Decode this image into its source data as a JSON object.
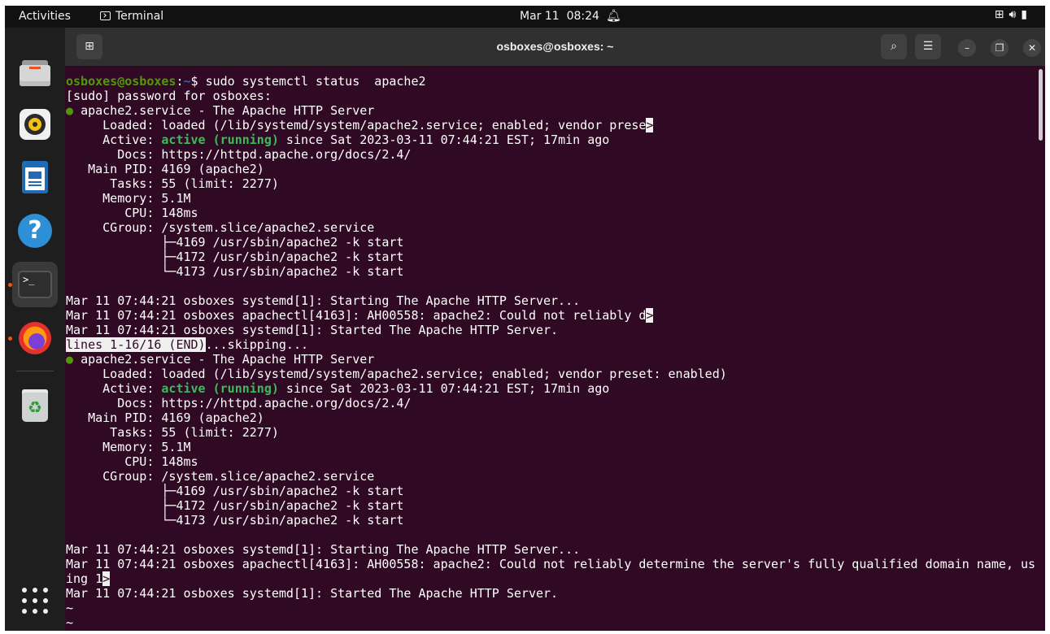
{
  "topbar": {
    "activities": "Activities",
    "app_name": "Terminal",
    "clock": "Mar 11  08:24"
  },
  "dock": {
    "items": [
      "files-icon",
      "rhythmbox-icon",
      "libreoffice-writer-icon",
      "help-icon",
      "terminal-icon",
      "firefox-icon",
      "trash-icon",
      "show-apps-icon"
    ]
  },
  "window": {
    "title": "osboxes@osboxes: ~"
  },
  "terminal": {
    "prompt_user": "osboxes@osboxes",
    "prompt_sep": ":",
    "prompt_path": "~",
    "prompt_symbol": "$ ",
    "command": "sudo systemctl status  apache2",
    "lines": {
      "sudo": "[sudo] password for osboxes:",
      "svc": "apache2.service - The Apache HTTP Server",
      "loaded_short": "     Loaded: loaded (/lib/systemd/system/apache2.service; enabled; vendor prese",
      "loaded_full": "     Loaded: loaded (/lib/systemd/system/apache2.service; enabled; vendor preset: enabled)",
      "active_label": "     Active: ",
      "active_state": "active (running)",
      "active_rest": " since Sat 2023-03-11 07:44:21 EST; 17min ago",
      "docs": "       Docs: https://httpd.apache.org/docs/2.4/",
      "mainpid": "   Main PID: 4169 (apache2)",
      "tasks": "      Tasks: 55 (limit: 2277)",
      "memory": "     Memory: 5.1M",
      "cpu": "        CPU: 148ms",
      "cgroup": "     CGroup: /system.slice/apache2.service",
      "proc1": "             ├─4169 /usr/sbin/apache2 -k start",
      "proc2": "             ├─4172 /usr/sbin/apache2 -k start",
      "proc3": "             └─4173 /usr/sbin/apache2 -k start",
      "log1": "Mar 11 07:44:21 osboxes systemd[1]: Starting The Apache HTTP Server...",
      "log2_short": "Mar 11 07:44:21 osboxes apachectl[4163]: AH00558: apache2: Could not reliably d",
      "log2_full": "Mar 11 07:44:21 osboxes apachectl[4163]: AH00558: apache2: Could not reliably determine the server's fully qualified domain name, us",
      "log2_wrap": "ing 1",
      "log3": "Mar 11 07:44:21 osboxes systemd[1]: Started The Apache HTTP Server.",
      "pager_status": "lines 1-16/16 (END)",
      "pager_skip": "...skipping...",
      "trunc_marker": ">",
      "bullet": "●",
      "tilde": "~"
    }
  }
}
